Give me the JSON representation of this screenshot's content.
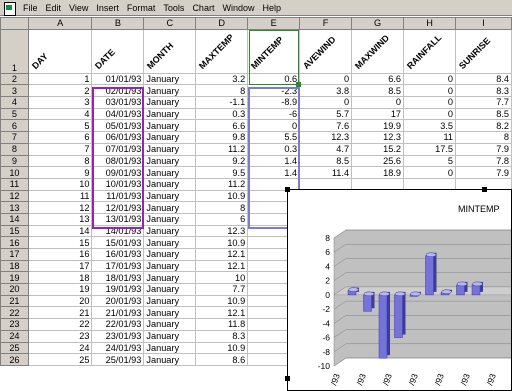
{
  "menu": [
    "File",
    "Edit",
    "View",
    "Insert",
    "Format",
    "Tools",
    "Chart",
    "Window",
    "Help"
  ],
  "columns": [
    "A",
    "B",
    "C",
    "D",
    "E",
    "F",
    "G",
    "H",
    "I"
  ],
  "headers": [
    "DAY",
    "DATE",
    "MONTH",
    "MAXTEMP",
    "MINTEMP",
    "AVEWIND",
    "MAXWIND",
    "RAINFALL",
    "SUNRISE"
  ],
  "rows": [
    [
      "1",
      "01/01/93",
      "January",
      "3.2",
      "0.6",
      "0",
      "6.6",
      "0",
      "8.4"
    ],
    [
      "2",
      "02/01/93",
      "January",
      "8",
      "-2.3",
      "3.8",
      "8.5",
      "0",
      "8.3"
    ],
    [
      "3",
      "03/01/93",
      "January",
      "-1.1",
      "-8.9",
      "0",
      "0",
      "0",
      "7.7"
    ],
    [
      "4",
      "04/01/93",
      "January",
      "0.3",
      "-6",
      "5.7",
      "17",
      "0",
      "8.5"
    ],
    [
      "5",
      "05/01/93",
      "January",
      "6.6",
      "0",
      "7.6",
      "19.9",
      "3.5",
      "8.2"
    ],
    [
      "6",
      "06/01/93",
      "January",
      "9.8",
      "5.5",
      "12.3",
      "12.3",
      "11",
      "8"
    ],
    [
      "7",
      "07/01/93",
      "January",
      "11.2",
      "0.3",
      "4.7",
      "15.2",
      "17.5",
      "7.9"
    ],
    [
      "8",
      "08/01/93",
      "January",
      "9.2",
      "1.4",
      "8.5",
      "25.6",
      "5",
      "7.8"
    ],
    [
      "9",
      "09/01/93",
      "January",
      "9.5",
      "1.4",
      "11.4",
      "18.9",
      "0",
      "7.9"
    ],
    [
      "10",
      "10/01/93",
      "January",
      "11.2",
      "",
      "",
      "",
      "",
      ""
    ],
    [
      "11",
      "11/01/93",
      "January",
      "10.9",
      "",
      "",
      "",
      "",
      ""
    ],
    [
      "12",
      "12/01/93",
      "January",
      "8",
      "",
      "",
      "",
      "",
      ""
    ],
    [
      "13",
      "13/01/93",
      "January",
      "6",
      "",
      "",
      "",
      "",
      ""
    ],
    [
      "14",
      "14/01/93",
      "January",
      "12.3",
      "",
      "",
      "",
      "",
      ""
    ],
    [
      "15",
      "15/01/93",
      "January",
      "10.9",
      "",
      "",
      "",
      "",
      ""
    ],
    [
      "16",
      "16/01/93",
      "January",
      "12.1",
      "",
      "",
      "",
      "",
      ""
    ],
    [
      "17",
      "17/01/93",
      "January",
      "12.1",
      "",
      "",
      "",
      "",
      ""
    ],
    [
      "18",
      "18/01/93",
      "January",
      "10",
      "",
      "",
      "",
      "",
      ""
    ],
    [
      "19",
      "19/01/93",
      "January",
      "7.7",
      "",
      "",
      "",
      "",
      ""
    ],
    [
      "20",
      "20/01/93",
      "January",
      "10.9",
      "",
      "",
      "",
      "",
      ""
    ],
    [
      "21",
      "21/01/93",
      "January",
      "12.1",
      "",
      "",
      "",
      "",
      ""
    ],
    [
      "22",
      "22/01/93",
      "January",
      "11.8",
      "",
      "",
      "",
      "",
      ""
    ],
    [
      "23",
      "23/01/93",
      "January",
      "8.3",
      "",
      "",
      "",
      "",
      ""
    ],
    [
      "24",
      "24/01/93",
      "January",
      "10.9",
      "",
      "",
      "",
      "",
      ""
    ],
    [
      "25",
      "25/01/93",
      "January",
      "8.6",
      "",
      "",
      "",
      "",
      ""
    ]
  ],
  "chart": {
    "title": "MINTEMP",
    "ticks": [
      "8",
      "6",
      "4",
      "2",
      "0",
      "-2",
      "-4",
      "-6",
      "-8",
      "-10"
    ],
    "x_labels": [
      "/93",
      "/93",
      "/93",
      "/93",
      "/93",
      "/93",
      "/93"
    ],
    "values": [
      0.6,
      -2.3,
      -8.9,
      -6,
      0,
      5.5,
      0.3,
      1.4,
      1.4
    ],
    "colors": {
      "bar": "#7373d9",
      "bar_top": "#b8b8f0",
      "bar_side": "#3c3c9c",
      "wall": "#c0c0c0"
    }
  }
}
